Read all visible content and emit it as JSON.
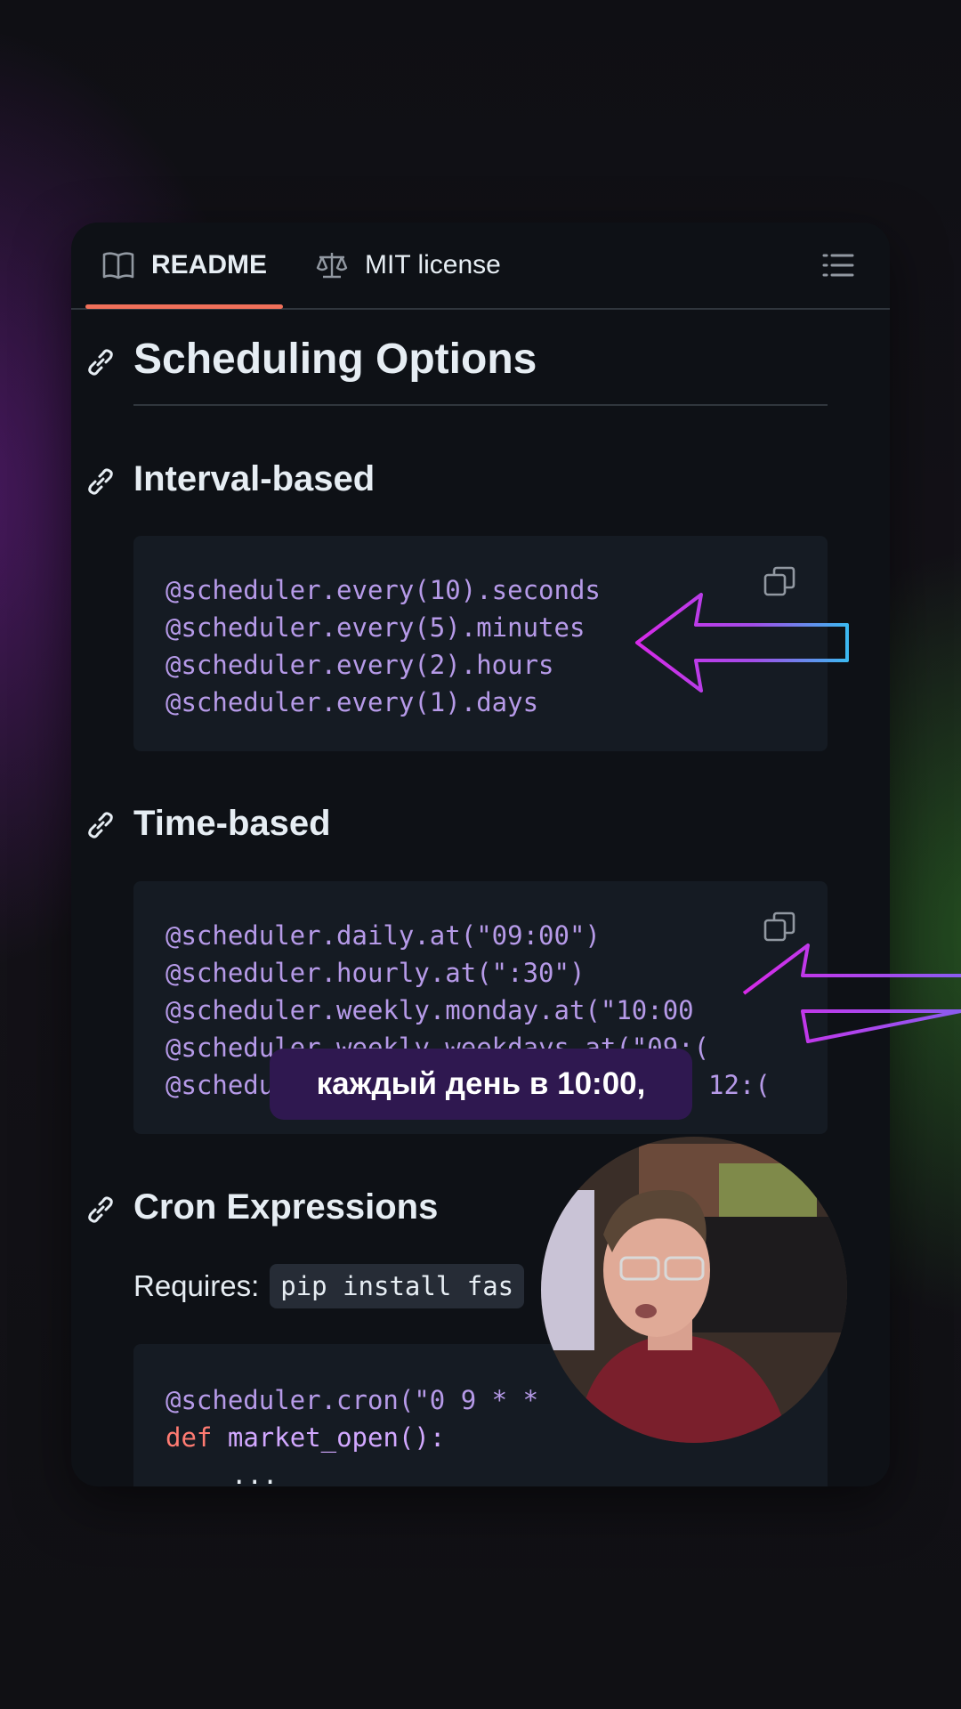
{
  "tabs": {
    "readme_label": "README",
    "license_label": "MIT license"
  },
  "sections": {
    "main_title": "Scheduling Options",
    "interval": {
      "title": "Interval-based",
      "lines": [
        "@scheduler.every(10).seconds",
        "@scheduler.every(5).minutes",
        "@scheduler.every(2).hours",
        "@scheduler.every(1).days"
      ]
    },
    "time": {
      "title": "Time-based",
      "lines": [
        "@scheduler.daily.at(\"09:00\")",
        "@scheduler.hourly.at(\":30\")",
        "@scheduler.weekly.monday.at(\"10:00",
        "@scheduler.weekly.weekdays.at(\"09:(",
        "@schedu",
        "12:("
      ]
    },
    "cron": {
      "title": "Cron Expressions",
      "requires_label": "Requires:",
      "requires_code": "pip install fas",
      "lines": [
        "@scheduler.cron(\"0 9 * * ",
        "def",
        "market_open():",
        "..."
      ]
    }
  },
  "caption": "каждый день в 10:00,",
  "colors": {
    "accent": "#f0705a",
    "arrow_magenta": "#d62ae8",
    "arrow_cyan": "#3cb8f0",
    "caption_bg": "#2f1850"
  },
  "icons": [
    "book-icon",
    "scale-icon",
    "list-icon",
    "link-icon",
    "copy-icon",
    "arrow-left-icon"
  ]
}
